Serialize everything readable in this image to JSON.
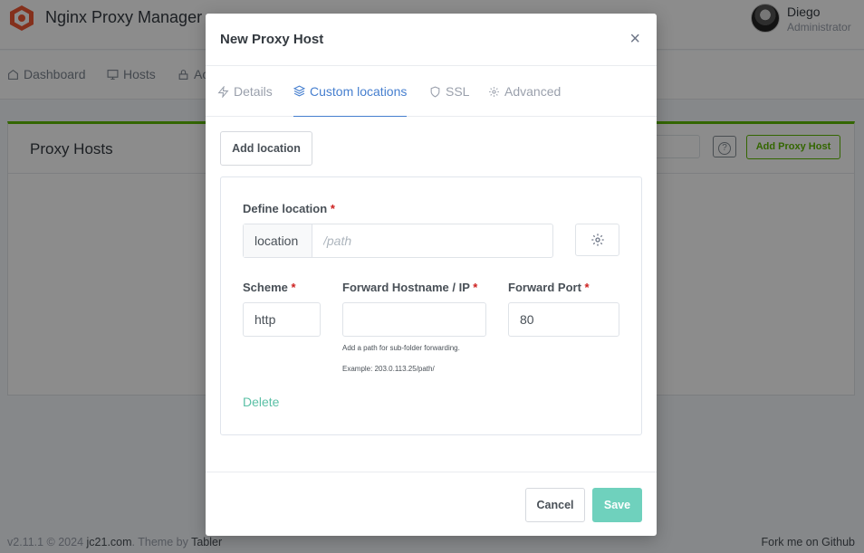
{
  "app": {
    "title": "Nginx Proxy Manager",
    "logo_icon": "nginx-proxy-manager-logo",
    "user": {
      "name": "Diego",
      "role": "Administrator"
    }
  },
  "nav": {
    "items": [
      {
        "label": "Dashboard",
        "icon": "home-icon"
      },
      {
        "label": "Hosts",
        "icon": "monitor-icon"
      },
      {
        "label": "Ac",
        "icon": "lock-icon"
      }
    ]
  },
  "page": {
    "card_title": "Proxy Hosts",
    "help_label": "?",
    "add_button": "Add Proxy Host"
  },
  "footer": {
    "version_text": "v2.11.1 © 2024 ",
    "site": "jc21.com",
    "theme_text": ". Theme by ",
    "theme_name": "Tabler",
    "github": "Fork me on Github"
  },
  "modal": {
    "title": "New Proxy Host",
    "close": "×",
    "tabs": [
      {
        "label": "Details",
        "icon": "zap-icon",
        "active": false
      },
      {
        "label": "Custom locations",
        "icon": "layers-icon",
        "active": true
      },
      {
        "label": "SSL",
        "icon": "shield-icon",
        "active": false
      },
      {
        "label": "Advanced",
        "icon": "gear-icon",
        "active": false
      }
    ],
    "add_location": "Add location",
    "location": {
      "define_label": "Define location",
      "required_mark": "*",
      "addon": "location",
      "path_placeholder": "/path",
      "path_value": "",
      "scheme_label": "Scheme",
      "scheme_value": "http",
      "hostname_label": "Forward Hostname / IP",
      "hostname_value": "",
      "hint_1": "Add a path for sub-folder forwarding.",
      "hint_2": "Example: 203.0.113.25/path/",
      "port_label": "Forward Port",
      "port_value": "80",
      "delete": "Delete"
    },
    "cancel": "Cancel",
    "save": "Save"
  },
  "colors": {
    "accent": "#467fcf",
    "green": "#5eba00",
    "save": "#6fd1bd",
    "required": "#cd201f"
  }
}
